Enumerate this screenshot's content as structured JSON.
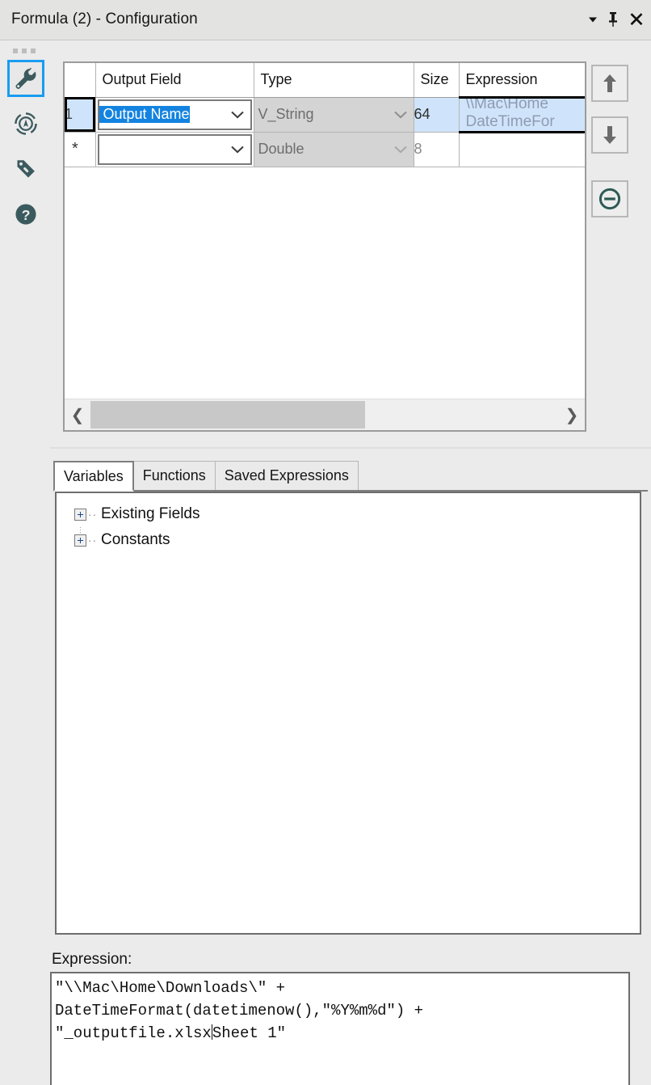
{
  "window": {
    "title": "Formula (2) - Configuration",
    "controls": [
      {
        "name": "dropdown-caret",
        "glyph": "▾"
      },
      {
        "name": "pin",
        "glyph": "📌"
      },
      {
        "name": "close",
        "glyph": "✕"
      }
    ]
  },
  "rail": {
    "items": [
      {
        "name": "configuration",
        "icon": "wrench-icon",
        "selected": true
      },
      {
        "name": "annotation",
        "icon": "compass-icon",
        "selected": false
      },
      {
        "name": "labels",
        "icon": "tag-icon",
        "selected": false
      },
      {
        "name": "help",
        "icon": "question-icon",
        "selected": false
      }
    ]
  },
  "grid": {
    "columns": [
      "",
      "Output Field",
      "Type",
      "Size",
      "Expression"
    ],
    "rows": [
      {
        "rownum": "1",
        "output_field": "Output Name",
        "output_field_selected": true,
        "type": "V_String",
        "size": "64",
        "expression_line1": "\\\\Mac\\Home",
        "expression_line2": "DateTimeFor",
        "selected": true
      },
      {
        "rownum": "*",
        "output_field": "",
        "output_field_selected": false,
        "type": "Double",
        "size": "8",
        "expression_line1": "",
        "expression_line2": "",
        "selected": false
      }
    ],
    "scrollbar": {
      "left_arrow": "❮",
      "right_arrow": "❯"
    },
    "side_buttons": [
      {
        "name": "move-up",
        "glyph": "↑"
      },
      {
        "name": "move-down",
        "glyph": "↓"
      },
      {
        "name": "remove-field",
        "glyph": "⊖"
      }
    ]
  },
  "tabs": [
    {
      "label": "Variables",
      "active": true
    },
    {
      "label": "Functions",
      "active": false
    },
    {
      "label": "Saved Expressions",
      "active": false
    }
  ],
  "tree": {
    "nodes": [
      {
        "label": "Existing Fields",
        "expander": "+"
      },
      {
        "label": "Constants",
        "expander": "+"
      }
    ]
  },
  "expression_editor": {
    "label": "Expression:",
    "line1": "\"\\\\Mac\\Home\\Downloads\\\" +",
    "line2": "DateTimeFormat(datetimenow(),\"%Y%m%d\") +",
    "line3_before_caret": "\"_outputfile.xlsx",
    "line3_after_caret": "Sheet 1\""
  },
  "colors": {
    "accent_selection": "#1383e0",
    "row_selection": "#cfe4fb",
    "rail_selected_border": "#189cf0",
    "panel_background": "#ebebeb",
    "titlebar_background": "#e3e3e1",
    "icon_teal": "#3b5a5e"
  }
}
